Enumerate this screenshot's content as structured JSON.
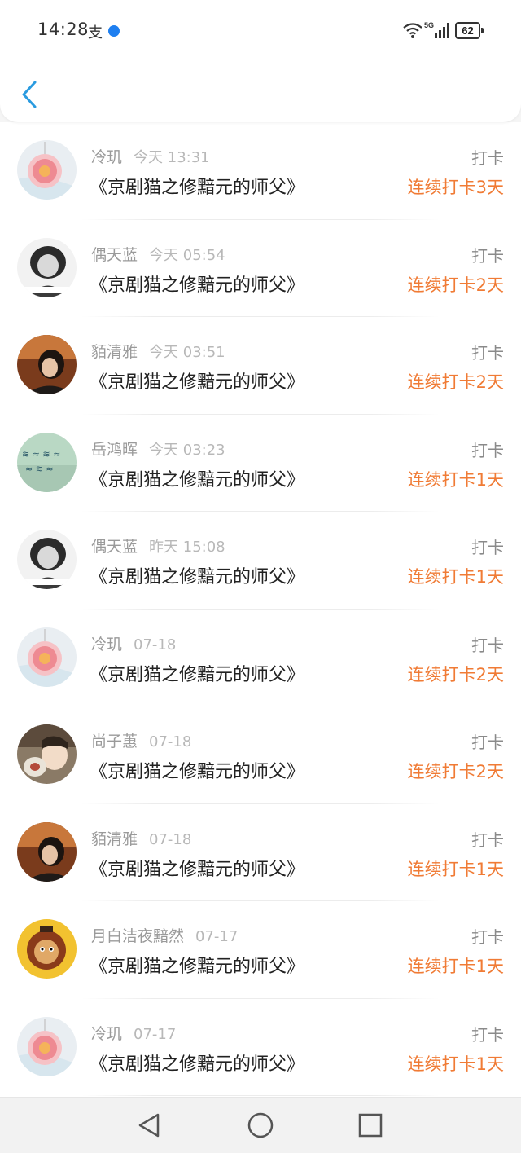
{
  "status_bar": {
    "time": "14:28",
    "alipay_glyph": "支",
    "network": "5G",
    "battery": "62"
  },
  "header": {
    "back_icon": "chevron-left-icon"
  },
  "colors": {
    "accent": "#f07b35",
    "back": "#2a9be0"
  },
  "entries": [
    {
      "user": "冷玑",
      "time": "今天 13:31",
      "book": "《京剧猫之修黯元的师父》",
      "action": "打卡",
      "streak": "连续打卡3天",
      "avatar": "pink-flower"
    },
    {
      "user": "偶天蓝",
      "time": "今天 05:54",
      "book": "《京剧猫之修黯元的师父》",
      "action": "打卡",
      "streak": "连续打卡2天",
      "avatar": "bw-girl"
    },
    {
      "user": "貊清雅",
      "time": "今天 03:51",
      "book": "《京剧猫之修黯元的师父》",
      "action": "打卡",
      "streak": "连续打卡2天",
      "avatar": "girl-portrait"
    },
    {
      "user": "岳鸿晖",
      "time": "今天 03:23",
      "book": "《京剧猫之修黯元的师父》",
      "action": "打卡",
      "streak": "连续打卡1天",
      "avatar": "green-text"
    },
    {
      "user": "偶天蓝",
      "time": "昨天 15:08",
      "book": "《京剧猫之修黯元的师父》",
      "action": "打卡",
      "streak": "连续打卡1天",
      "avatar": "bw-girl"
    },
    {
      "user": "冷玑",
      "time": "07-18",
      "book": "《京剧猫之修黯元的师父》",
      "action": "打卡",
      "streak": "连续打卡2天",
      "avatar": "pink-flower"
    },
    {
      "user": "尚子蕙",
      "time": "07-18",
      "book": "《京剧猫之修黯元的师父》",
      "action": "打卡",
      "streak": "连续打卡2天",
      "avatar": "child"
    },
    {
      "user": "貊清雅",
      "time": "07-18",
      "book": "《京剧猫之修黯元的师父》",
      "action": "打卡",
      "streak": "连续打卡1天",
      "avatar": "girl-portrait"
    },
    {
      "user": "月白洁夜黯然",
      "time": "07-17",
      "book": "《京剧猫之修黯元的师父》",
      "action": "打卡",
      "streak": "连续打卡1天",
      "avatar": "cartoon-lion"
    },
    {
      "user": "冷玑",
      "time": "07-17",
      "book": "《京剧猫之修黯元的师父》",
      "action": "打卡",
      "streak": "连续打卡1天",
      "avatar": "pink-flower"
    }
  ],
  "navbar": {
    "back": "nav-back-icon",
    "home": "nav-home-icon",
    "recents": "nav-recents-icon"
  }
}
